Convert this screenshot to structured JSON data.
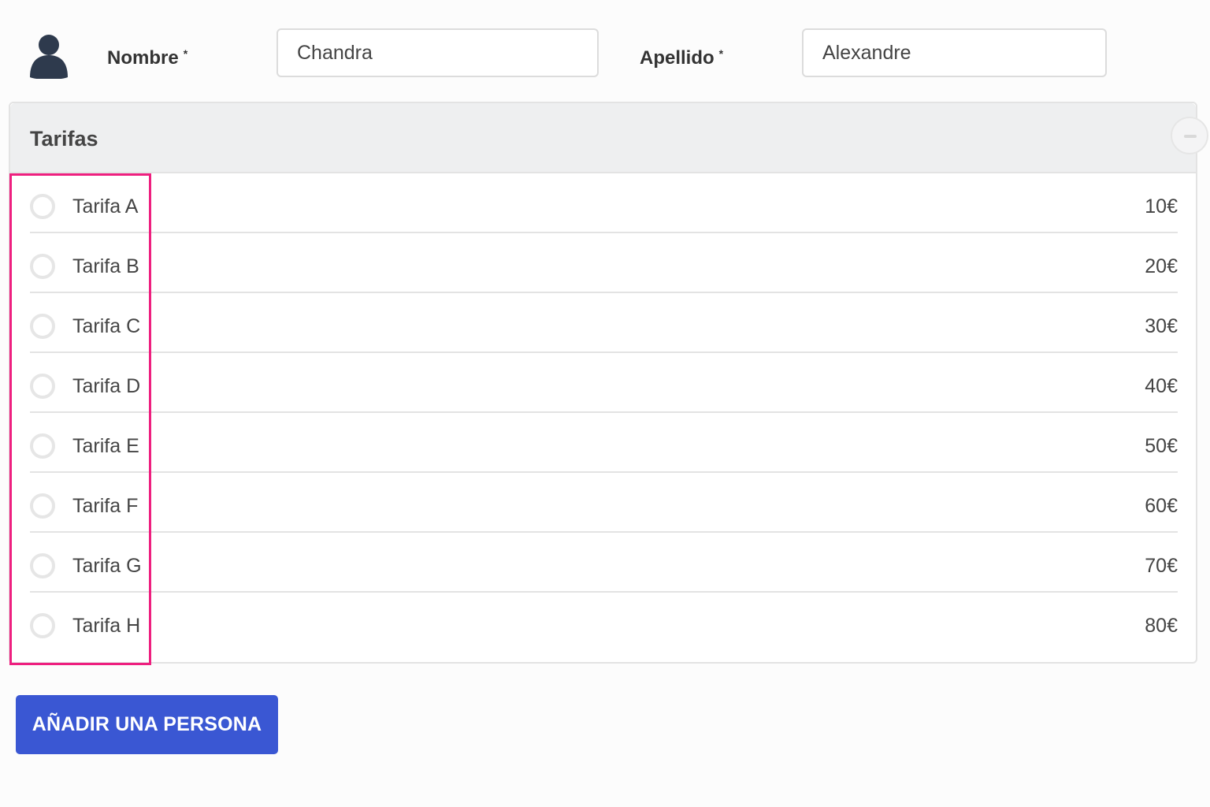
{
  "person": {
    "avatar_icon": "user-avatar-icon",
    "first_name_label": "Nombre",
    "first_name_required_mark": "*",
    "first_name_value": "Chandra",
    "last_name_label": "Apellido",
    "last_name_required_mark": "*",
    "last_name_value": "Alexandre"
  },
  "rates_panel": {
    "title": "Tarifas",
    "collapse_icon": "minus-icon",
    "items": [
      {
        "label": "Tarifa A",
        "price": "10€",
        "selected": false
      },
      {
        "label": "Tarifa B",
        "price": "20€",
        "selected": false
      },
      {
        "label": "Tarifa C",
        "price": "30€",
        "selected": false
      },
      {
        "label": "Tarifa D",
        "price": "40€",
        "selected": false
      },
      {
        "label": "Tarifa E",
        "price": "50€",
        "selected": false
      },
      {
        "label": "Tarifa F",
        "price": "60€",
        "selected": false
      },
      {
        "label": "Tarifa G",
        "price": "70€",
        "selected": false
      },
      {
        "label": "Tarifa H",
        "price": "80€",
        "selected": false
      }
    ]
  },
  "actions": {
    "add_person_label": "AÑADIR UNA PERSONA"
  },
  "colors": {
    "accent": "#3a57d3",
    "highlight": "#ee1f7f",
    "panel_header_bg": "#eeeff0"
  }
}
